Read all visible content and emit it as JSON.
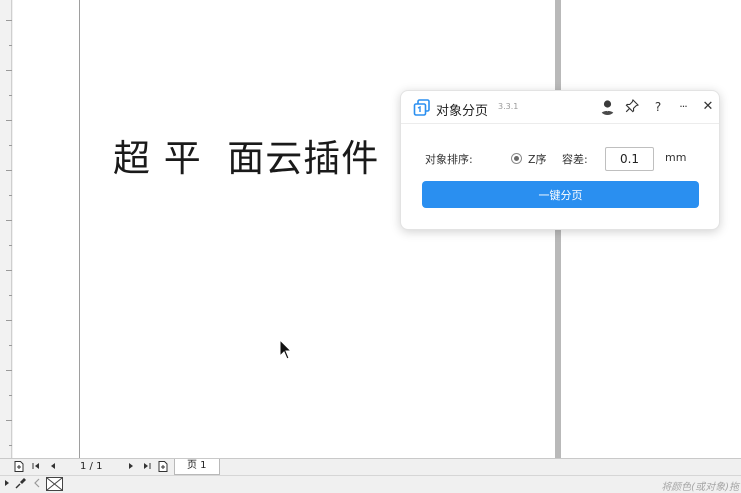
{
  "canvas": {
    "headline": "超 平  面云插件"
  },
  "panel": {
    "title": "对象分页",
    "version": "3.3.1",
    "icons": {
      "logo": "copy-pages-icon",
      "avatar": "user-avatar",
      "pin": "pin-icon",
      "help": "?",
      "more": "···",
      "close": "✕"
    },
    "sort_label": "对象排序:",
    "sort_option": "Z序",
    "tolerance_label": "容差:",
    "tolerance_value": "0.1",
    "unit": "mm",
    "primary_button": "一键分页",
    "accent_color": "#2a8ff0"
  },
  "pagebar": {
    "count": "1 / 1",
    "page_tab": "页 1"
  },
  "statusbar": {
    "hint": "将颜色(或对象)拖"
  }
}
